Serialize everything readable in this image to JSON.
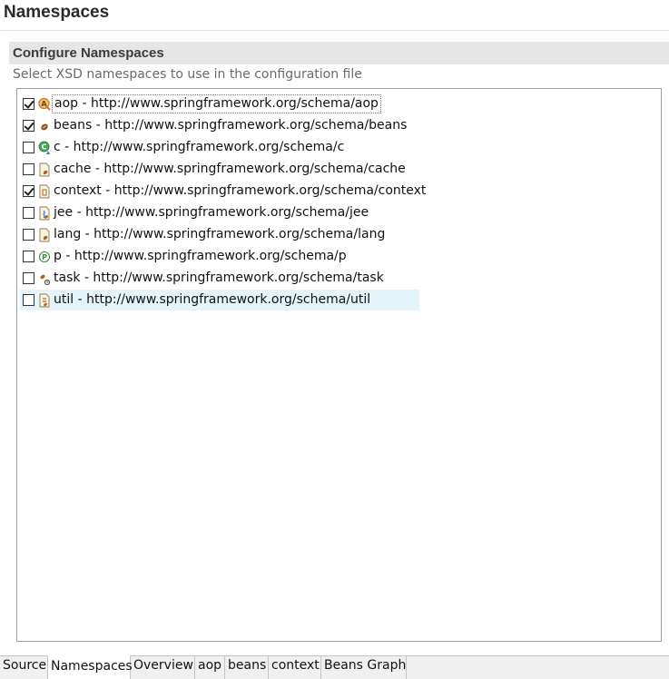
{
  "page": {
    "title": "Namespaces"
  },
  "section": {
    "title": "Configure Namespaces",
    "description": "Select XSD namespaces to use in the configuration file"
  },
  "namespaces": [
    {
      "label": "aop - http://www.springframework.org/schema/aop",
      "checked": true,
      "icon": "aop-icon"
    },
    {
      "label": "beans - http://www.springframework.org/schema/beans",
      "checked": true,
      "icon": "bean-icon"
    },
    {
      "label": "c - http://www.springframework.org/schema/c",
      "checked": false,
      "icon": "c-namespace-icon"
    },
    {
      "label": "cache - http://www.springframework.org/schema/cache",
      "checked": false,
      "icon": "xml-file-icon"
    },
    {
      "label": "context - http://www.springframework.org/schema/context",
      "checked": true,
      "icon": "context-file-icon"
    },
    {
      "label": "jee - http://www.springframework.org/schema/jee",
      "checked": false,
      "icon": "jee-icon"
    },
    {
      "label": "lang - http://www.springframework.org/schema/lang",
      "checked": false,
      "icon": "xml-file-icon"
    },
    {
      "label": "p - http://www.springframework.org/schema/p",
      "checked": false,
      "icon": "p-namespace-icon"
    },
    {
      "label": "task - http://www.springframework.org/schema/task",
      "checked": false,
      "icon": "task-icon"
    },
    {
      "label": "util - http://www.springframework.org/schema/util",
      "checked": false,
      "icon": "util-icon"
    }
  ],
  "tabs": [
    {
      "label": "Source"
    },
    {
      "label": "Namespaces"
    },
    {
      "label": "Overview"
    },
    {
      "label": "aop"
    },
    {
      "label": "beans"
    },
    {
      "label": "context"
    },
    {
      "label": "Beans Graph"
    }
  ],
  "active_tab": "Namespaces"
}
